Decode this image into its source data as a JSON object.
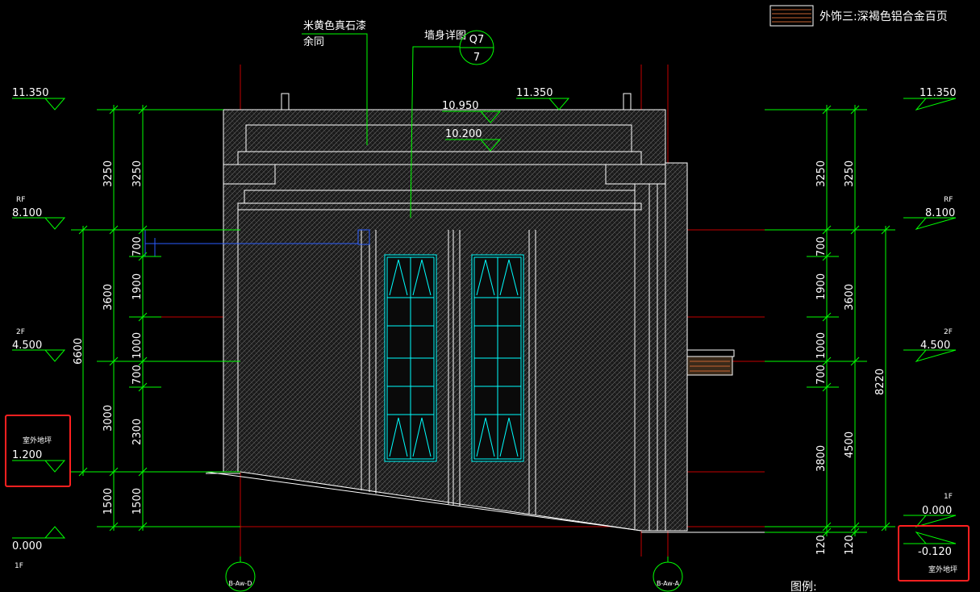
{
  "legend": {
    "label": "外饰三:深褐色铝合金百页",
    "color": "#c86432"
  },
  "callouts": {
    "material": [
      "米黄色真石漆",
      "余同"
    ],
    "wall_detail": "墙身详图",
    "detail_ref": {
      "top": "Q7",
      "bottom": "7"
    }
  },
  "levels": {
    "top_left": "11.350",
    "top_center": "11.350",
    "top_right": "11.350",
    "parapet_1": "10.950",
    "parapet_2": "10.200",
    "rf_label_left": "RF",
    "rf_left": "8.100",
    "rf_label_right": "RF",
    "rf_right": "8.100",
    "f2_label_left": "2F",
    "f2_left": "4.500",
    "f2_label_right": "2F",
    "f2_right": "4.500",
    "outdoor_label_left": "室外地坪",
    "outdoor_left": "1.200",
    "zero_left": "0.000",
    "f1_label_left": "1F",
    "f1_label_right": "1F",
    "zero_right": "0.000",
    "outdoor_right": "-0.120",
    "outdoor_label_right": "室外地坪"
  },
  "dims_left": {
    "outer": [
      "3250",
      "3600",
      "3000",
      "1500"
    ],
    "overall": "6600",
    "inner": [
      "3250",
      "700",
      "1900",
      "1000",
      "700",
      "2300",
      "1500"
    ]
  },
  "dims_right": {
    "outer": [
      "3250",
      "1900",
      "1000",
      "700",
      "3800",
      "120"
    ],
    "mid": [
      "3250",
      "700",
      "3600",
      "4500",
      "120"
    ],
    "overall": "8220"
  },
  "axes": {
    "left": "B-Aw-D",
    "right": "B-Aw-A"
  },
  "footer": {
    "legend_title": "图例:"
  },
  "colors": {
    "background": "#000000",
    "dimension": "#00ff00",
    "outline": "#ffffff",
    "axis": "#c40000",
    "window": "#00ffff",
    "highlight": "#ff2020"
  }
}
